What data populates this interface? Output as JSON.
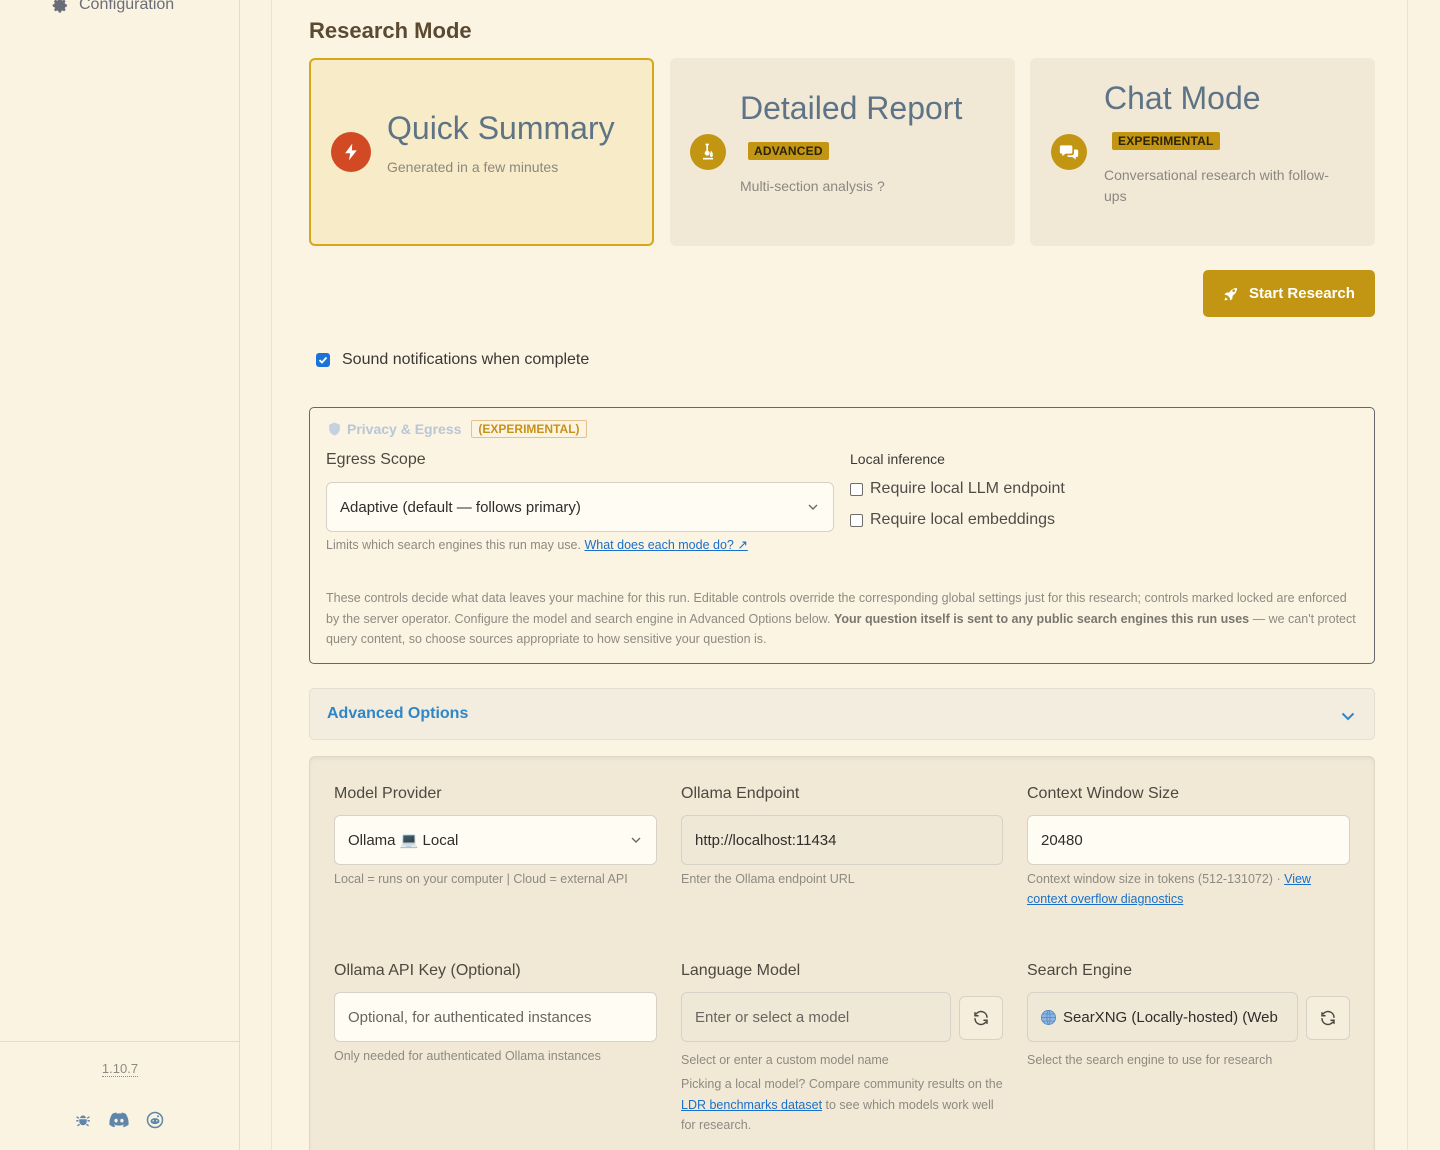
{
  "sidebar": {
    "nav_configuration": "Configuration",
    "version": "1.10.7",
    "footer_icons": [
      "bug-icon",
      "discord-icon",
      "reddit-icon"
    ]
  },
  "research_mode": {
    "title": "Research Mode",
    "modes": [
      {
        "title": "Quick Summary",
        "description": "Generated in a few minutes",
        "badge": "",
        "icon": "bolt-icon",
        "active": true
      },
      {
        "title": "Detailed Report",
        "description": "Multi-section analysis ?",
        "badge": "ADVANCED",
        "icon": "microscope-icon",
        "active": false
      },
      {
        "title": "Chat Mode",
        "description": "Conversational research with follow-ups",
        "badge": "EXPERIMENTAL",
        "icon": "chat-icon",
        "active": false
      }
    ],
    "start_button": "Start Research",
    "sound_notifications": "Sound notifications when complete"
  },
  "privacy": {
    "legend": "Privacy & Egress",
    "legend_tag": "(EXPERIMENTAL)",
    "egress_scope_label": "Egress Scope",
    "egress_scope_value": "Adaptive (default — follows primary)",
    "egress_help": "Limits which search engines this run may use.",
    "egress_help_link": "What does each mode do? ↗",
    "local_inference_label": "Local inference",
    "require_llm": "Require local LLM endpoint",
    "require_embeddings": "Require local embeddings",
    "note_part1": "These controls decide what data leaves your machine for this run. Editable controls override the corresponding global settings just for this research; controls marked locked are enforced by the server operator. Configure the model and search engine in Advanced Options below.",
    "note_bold": "Your question itself is sent to any public search engines this run uses",
    "note_part2": "— we can't protect query content, so choose sources appropriate to how sensitive your question is."
  },
  "advanced": {
    "toggle_label": "Advanced Options",
    "model_provider_label": "Model Provider",
    "model_provider_value": "Ollama 💻 Local",
    "model_provider_help": "Local = runs on your computer | Cloud = external API",
    "ollama_endpoint_label": "Ollama Endpoint",
    "ollama_endpoint_value": "http://localhost:11434",
    "ollama_endpoint_help": "Enter the Ollama endpoint URL",
    "context_window_label": "Context Window Size",
    "context_window_value": "20480",
    "context_window_help": "Context window size in tokens (512-131072) ·",
    "context_window_link": "View context overflow diagnostics",
    "api_key_label": "Ollama API Key (Optional)",
    "api_key_placeholder": "Optional, for authenticated instances",
    "api_key_help": "Only needed for authenticated Ollama instances",
    "language_model_label": "Language Model",
    "language_model_placeholder": "Enter or select a model",
    "language_model_help": "Select or enter a custom model name",
    "language_model_note_1": "Picking a local model? Compare community results on the",
    "language_model_note_link": "LDR benchmarks dataset",
    "language_model_note_2": "to see which models work well for research.",
    "search_engine_label": "Search Engine",
    "search_engine_value": "SearXNG (Locally-hosted) (Web",
    "search_engine_help": "Select the search engine to use for research"
  },
  "colors": {
    "accent": "#c29612",
    "quick_icon": "#d24a24",
    "link": "#1a6fc9",
    "advanced_toggle": "#2f86c6"
  }
}
